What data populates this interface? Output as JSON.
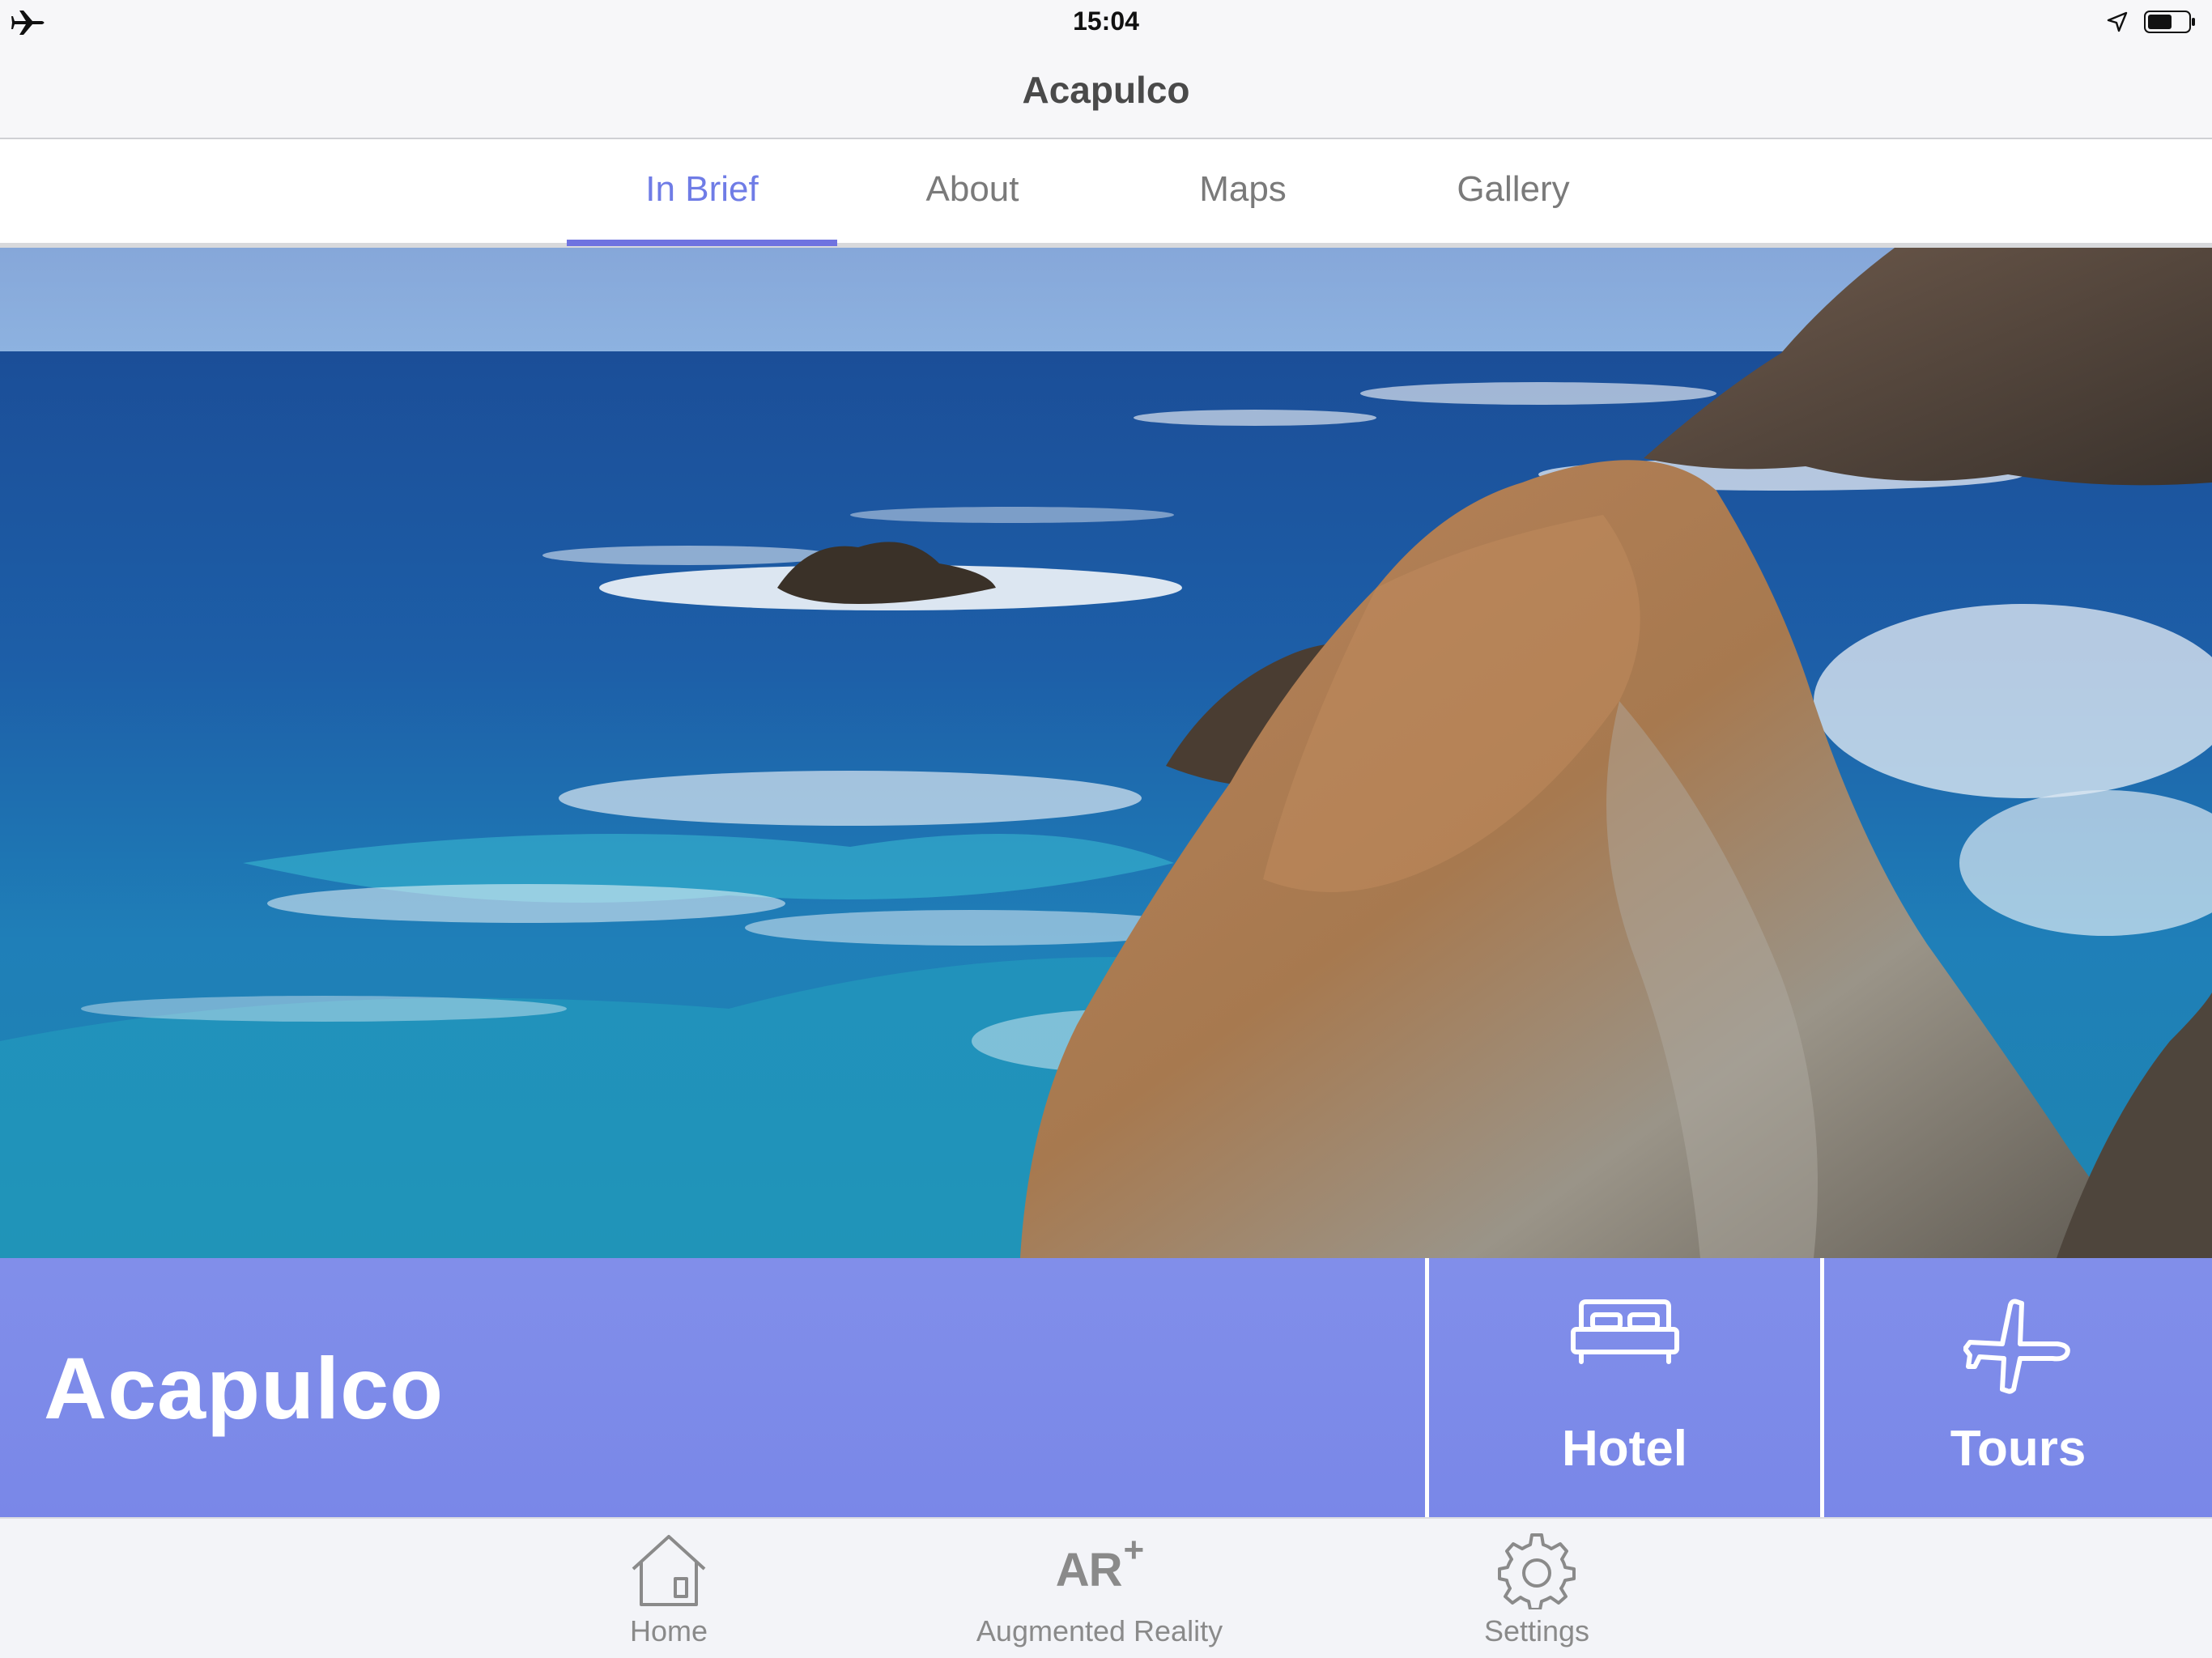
{
  "status_bar": {
    "time": "15:04",
    "icons": [
      "airplane-mode-icon",
      "location-arrow-icon",
      "battery-icon"
    ],
    "battery_level": 0.6
  },
  "nav": {
    "title": "Acapulco"
  },
  "tabs": {
    "items": [
      {
        "label": "In Brief",
        "active": true
      },
      {
        "label": "About",
        "active": false
      },
      {
        "label": "Maps",
        "active": false
      },
      {
        "label": "Gallery",
        "active": false
      }
    ],
    "accent_color": "#6f73e0"
  },
  "hero": {
    "image_subject": "rocky-coastline-ocean-photo"
  },
  "banner": {
    "title": "Acapulco",
    "background_color": "#7c8ae9",
    "tiles": [
      {
        "label": "Hotel",
        "icon": "bed-icon"
      },
      {
        "label": "Tours",
        "icon": "airplane-icon"
      }
    ]
  },
  "tabbar": {
    "items": [
      {
        "label": "Home",
        "icon": "home-icon"
      },
      {
        "label": "Augmented Reality",
        "icon": "ar-icon",
        "icon_text": "AR",
        "icon_sup": "+"
      },
      {
        "label": "Settings",
        "icon": "gear-icon"
      }
    ]
  }
}
